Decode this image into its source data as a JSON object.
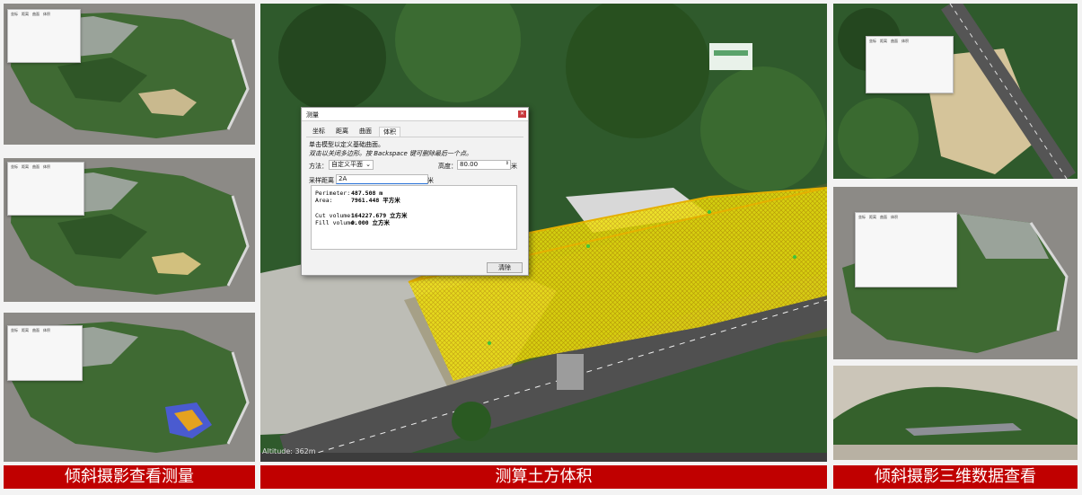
{
  "captions": {
    "left": "倾斜摄影查看测量",
    "center": "测算土方体积",
    "right": "倾斜摄影三维数据查看"
  },
  "dialog": {
    "title": "测量",
    "tabs": [
      "坐标",
      "距离",
      "曲面",
      "体积"
    ],
    "active_tab": "体积",
    "instruction_1": "单击模型以定义基础曲面。",
    "instruction_2": "双击以关闭多边形。按 Backspace 键可删除最后一个点。",
    "method_label": "方法：",
    "method_value": "自定义平面",
    "height_label": "高度：",
    "height_value": "80.00",
    "height_unit": "米",
    "sampling_label": "采样距离",
    "sampling_value": "2A",
    "sampling_unit": "米",
    "results": {
      "perimeter_label": "Perimeter:",
      "perimeter_value": "487.508 m",
      "area_label": "Area:",
      "area_value": "7961.448 平方米",
      "cut_label": "Cut volume:",
      "cut_value": "164227.679 立方米",
      "fill_label": "Fill volume:",
      "fill_value": "0.000 立方米"
    },
    "clear_button": "清除"
  },
  "scale_text": "Altitude: 362m",
  "colors": {
    "caption_bg": "#c00000",
    "vegetation": "#2e5a2a",
    "point_grid": "#f2e600",
    "terrain_bg": "#8c8a86"
  }
}
